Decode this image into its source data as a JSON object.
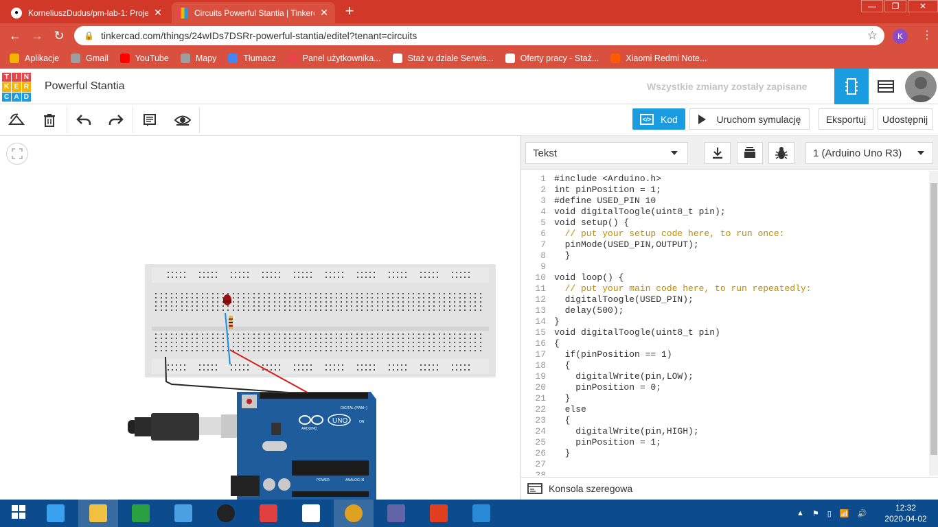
{
  "browser": {
    "tabs": [
      {
        "title": "KorneliuszDudus/pm-lab-1: Proje",
        "icon": "github-icon",
        "active": false
      },
      {
        "title": "Circuits Powerful Stantia | Tinkerc",
        "icon": "tinkercad-icon",
        "active": true
      }
    ],
    "new_tab": "+",
    "window_buttons": [
      "—",
      "❐",
      "✕"
    ],
    "url": "tinkercad.com/things/24wIDs7DSRr-powerful-stantia/editel?tenant=circuits",
    "profile_initial": "K",
    "bookmarks": [
      {
        "label": "Aplikacje",
        "icon": "apps-icon",
        "color": "#f4b400"
      },
      {
        "label": "Gmail",
        "icon": "globe-icon",
        "color": "#9e9e9e"
      },
      {
        "label": "YouTube",
        "icon": "youtube-icon",
        "color": "#ff0000"
      },
      {
        "label": "Mapy",
        "icon": "globe-icon",
        "color": "#9e9e9e"
      },
      {
        "label": "Tłumacz",
        "icon": "translate-icon",
        "color": "#4285f4"
      },
      {
        "label": "Panel użytkownika...",
        "icon": "panel-icon",
        "color": "#e8454a"
      },
      {
        "label": "Staż w dziale Serwis...",
        "icon": "bookmark-icon",
        "color": "#ffffff"
      },
      {
        "label": "Oferty pracy - Staż...",
        "icon": "bookmark-icon",
        "color": "#ffffff"
      },
      {
        "label": "Xiaomi Redmi Note...",
        "icon": "allegro-icon",
        "color": "#ff5a00"
      }
    ]
  },
  "tinkercad": {
    "logo_letters": [
      "T",
      "I",
      "N",
      "K",
      "E",
      "R",
      "C",
      "A",
      "D"
    ],
    "project_title": "Powerful Stantia",
    "save_status": "Wszystkie zmiany zostały zapisane",
    "buttons": {
      "code": "Kod",
      "simulate": "Uruchom symulację",
      "export": "Eksportuj",
      "share": "Udostępnij"
    },
    "code_panel": {
      "mode": "Tekst",
      "board": "1 (Arduino Uno R3)",
      "console": "Konsola szeregowa",
      "line_numbers": [
        "1",
        "2",
        "3",
        "4",
        "5",
        "6",
        "7",
        "8",
        "9",
        "10",
        "11",
        "12",
        "13",
        "14",
        "15",
        "16",
        "17",
        "18",
        "19",
        "20",
        "21",
        "22",
        "23",
        "24",
        "25",
        "26",
        "27",
        "28"
      ],
      "code_lines": [
        "#include <Arduino.h>",
        "int pinPosition = 1;",
        "#define USED_PIN 10",
        "void digitalToogle(uint8_t pin);",
        "void setup() {",
        "  // put your setup code here, to run once:",
        "  pinMode(USED_PIN,OUTPUT);",
        "  }",
        "",
        "void loop() {",
        "  // put your main code here, to run repeatedly:",
        "  digitalToogle(USED_PIN);",
        "  delay(500);",
        "}",
        "void digitalToogle(uint8_t pin)",
        "{",
        "  if(pinPosition == 1)",
        "  {",
        "    digitalWrite(pin,LOW);",
        "    pinPosition = 0;",
        "  }",
        "  else",
        "  {",
        "    digitalWrite(pin,HIGH);",
        "    pinPosition = 1;",
        "  }",
        "",
        ""
      ]
    },
    "board_labels": {
      "digital": "DIGITAL (PWM~)",
      "arduino": "ARDUINO",
      "uno": "UNO",
      "power": "POWER",
      "analog": "ANALOG IN",
      "on": "ON"
    }
  },
  "taskbar": {
    "apps": [
      "windows-start-icon",
      "ie-icon",
      "explorer-icon",
      "store-icon",
      "rocket-icon",
      "camera-icon",
      "paint-icon",
      "hp-icon",
      "chrome-icon",
      "teams-icon",
      "office-icon",
      "vscode-icon"
    ],
    "time": "12:32",
    "date": "2020-04-02"
  },
  "colors": {
    "chrome_red": "#d13827",
    "tinkercad_blue": "#1a9ce0",
    "arduino_blue": "#1e5c9c",
    "taskbar": "#0d4c8c"
  }
}
